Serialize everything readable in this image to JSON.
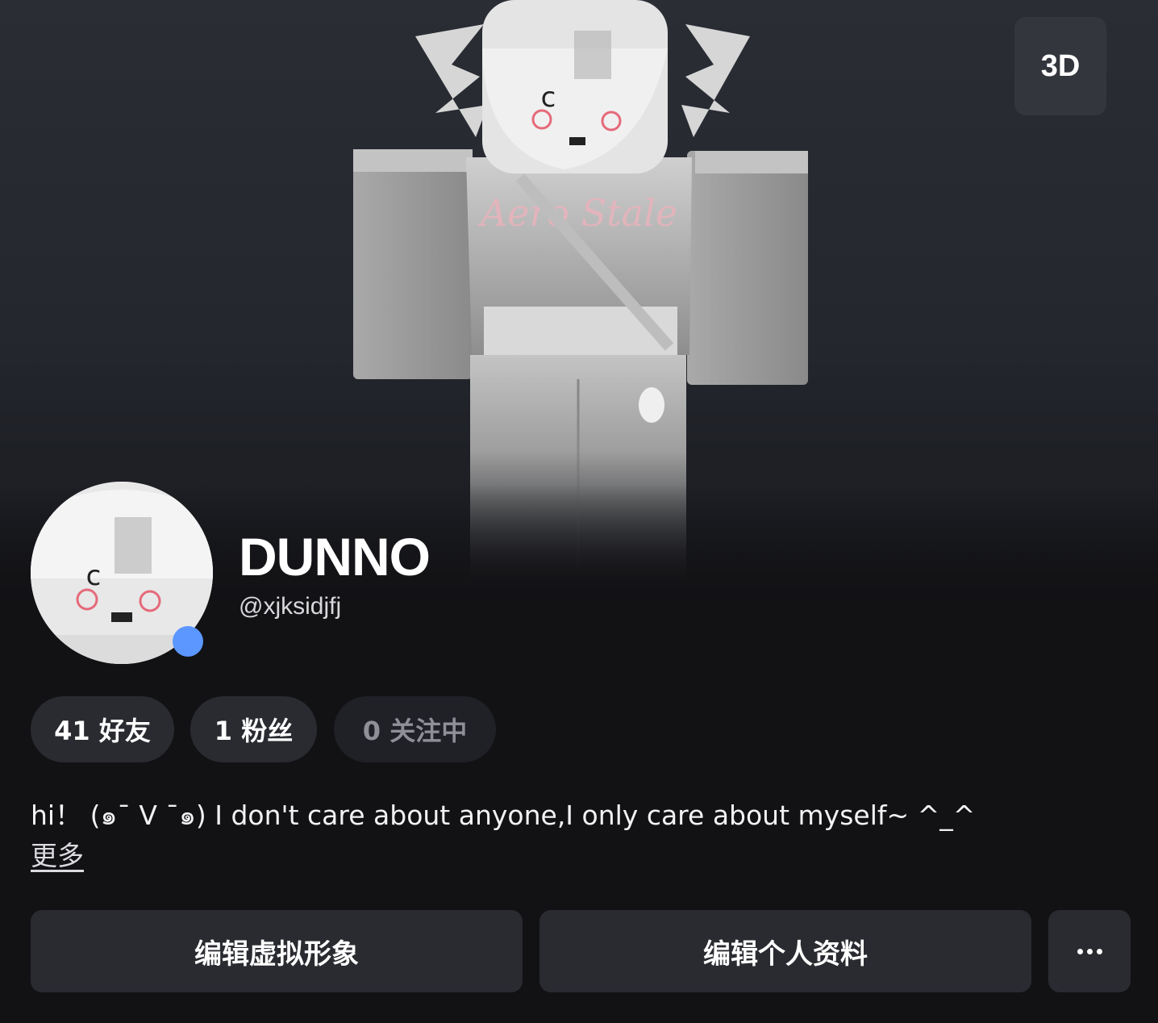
{
  "header": {
    "view_toggle_label": "3D"
  },
  "profile": {
    "display_name": "DUNNO",
    "username": "@xjksidjfj",
    "online": true,
    "presence_color": "#5c97ff"
  },
  "stats": {
    "friends": "41 好友",
    "followers": "1 粉丝",
    "following": "0 关注中"
  },
  "bio": {
    "text": "hi！ (๑¯ V ¯๑) I don't care about anyone,I only care about myself~ ^_^",
    "more_label": "更多"
  },
  "actions": {
    "edit_avatar_label": "编辑虚拟形象",
    "edit_profile_label": "编辑个人资料",
    "more_icon": "more-horizontal-icon"
  },
  "colors": {
    "background": "#121215",
    "surface": "#2a2b31",
    "accent_presence": "#5c97ff"
  }
}
